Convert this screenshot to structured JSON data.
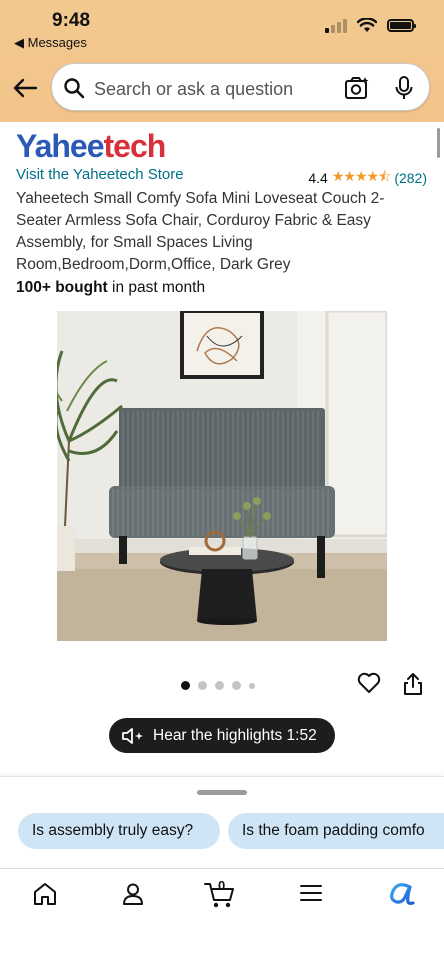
{
  "status_bar": {
    "time": "9:48",
    "back_app": "Messages"
  },
  "search": {
    "placeholder": "Search or ask a question"
  },
  "product": {
    "brand_part1": "Yahee",
    "brand_part2": "tech",
    "store_link": "Visit the Yaheetech Store",
    "rating_value": "4.4",
    "rating_stars": 4.4,
    "rating_count": "(282)",
    "title": "Yaheetech Small Comfy Sofa Mini Loveseat Couch 2-Seater Armless Sofa Chair, Corduroy Fabric & Easy Assembly, for Small Spaces Living Room,Bedroom,Dorm,Office, Dark Grey",
    "bought_bold": "100+ bought",
    "bought_rest": " in past month"
  },
  "gallery": {
    "total_dots": 5,
    "active_index": 0
  },
  "audio": {
    "label": "Hear the highlights 1:52"
  },
  "suggestions": [
    "Is assembly truly easy?",
    "Is the foam padding comfo"
  ],
  "nav": [
    "home-icon",
    "account-icon",
    "cart-icon",
    "menu-icon",
    "rufus-icon"
  ],
  "nav_cart_count": "0",
  "colors": {
    "header": "#f3c48a",
    "link": "#007185",
    "star": "#f09a2c",
    "chip": "#cfe5f6",
    "brand_blue": "#2a5ab6",
    "brand_red": "#d8303b"
  }
}
